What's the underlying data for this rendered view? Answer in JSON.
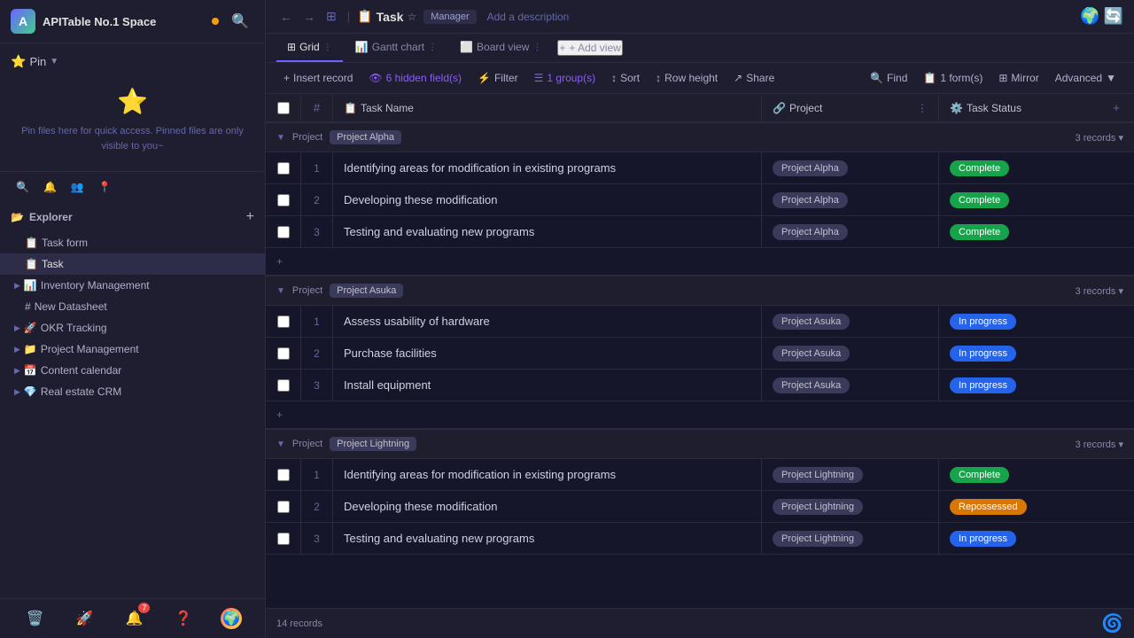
{
  "app": {
    "space_name": "APITable No.1 Space",
    "space_dot_color": "#f59e0b",
    "avatar_letter": "A"
  },
  "sidebar": {
    "pin_label": "Pin",
    "pin_empty_text": "Pin files here for quick access. Pinned files are only visible to you~",
    "explorer_label": "Explorer",
    "nav_items": [
      {
        "icon": "👤",
        "label": "",
        "type": "user"
      },
      {
        "icon": "🔍",
        "label": "",
        "type": "search"
      },
      {
        "icon": "🚀",
        "label": "",
        "type": "rocket"
      },
      {
        "icon": "📍",
        "label": "",
        "type": "pin"
      }
    ],
    "tree_items": [
      {
        "icon": "📋",
        "label": "Task form",
        "color": "#ef4444",
        "indent": 1,
        "active": false
      },
      {
        "icon": "📋",
        "label": "Task",
        "color": "#ef4444",
        "indent": 1,
        "active": true
      },
      {
        "icon": "📊",
        "label": "Inventory Management",
        "color": "#6c63ff",
        "indent": 0,
        "active": false,
        "has_children": true
      },
      {
        "icon": "#",
        "label": "New Datasheet",
        "color": "#8888aa",
        "indent": 1,
        "active": false
      },
      {
        "icon": "🚀",
        "label": "OKR Tracking",
        "color": "#f59e0b",
        "indent": 0,
        "active": false,
        "has_children": true
      },
      {
        "icon": "📁",
        "label": "Project Management",
        "color": "#f59e0b",
        "indent": 0,
        "active": false,
        "has_children": true
      },
      {
        "icon": "📅",
        "label": "Content calendar",
        "color": "#6c63ff",
        "indent": 0,
        "active": false,
        "has_children": true
      },
      {
        "icon": "💎",
        "label": "Real estate CRM",
        "color": "#f59e0b",
        "indent": 0,
        "active": false,
        "has_children": true
      }
    ],
    "bottom_icons": [
      "🗑️",
      "🚀",
      "👤"
    ],
    "notification_count": 7
  },
  "header": {
    "task_title": "Task",
    "manager_label": "Manager",
    "add_description": "Add a description"
  },
  "view_tabs": [
    {
      "label": "Grid",
      "icon": "⊞",
      "active": true,
      "dot": false
    },
    {
      "label": "Gantt chart",
      "icon": "📊",
      "active": false
    },
    {
      "label": "Board view",
      "icon": "⬜",
      "active": false
    }
  ],
  "add_view_label": "+ Add view",
  "action_bar": {
    "insert_record": "Insert record",
    "hidden_fields": "6 hidden field(s)",
    "filter": "Filter",
    "group": "1 group(s)",
    "sort": "Sort",
    "row_height": "Row height",
    "share": "Share",
    "find": "Find",
    "form": "1 form(s)",
    "mirror": "Mirror",
    "advanced": "Advanced"
  },
  "columns": [
    {
      "label": "Task Name",
      "icon": "📋"
    },
    {
      "label": "Project",
      "icon": "🔗"
    },
    {
      "label": "Task Status",
      "icon": "⚙️"
    }
  ],
  "groups": [
    {
      "id": "group_alpha",
      "project_label": "Project",
      "project_name": "Project Alpha",
      "records_count": "3 records",
      "rows": [
        {
          "num": 1,
          "name": "Identifying areas for modification in existing programs",
          "project": "Project Alpha",
          "status": "Complete",
          "status_class": "tag-green"
        },
        {
          "num": 2,
          "name": "Developing these modification",
          "project": "Project Alpha",
          "status": "Complete",
          "status_class": "tag-green"
        },
        {
          "num": 3,
          "name": "Testing and evaluating new programs",
          "project": "Project Alpha",
          "status": "Complete",
          "status_class": "tag-green"
        }
      ]
    },
    {
      "id": "group_asuka",
      "project_label": "Project",
      "project_name": "Project Asuka",
      "records_count": "3 records",
      "rows": [
        {
          "num": 1,
          "name": "Assess usability of hardware",
          "project": "Project Asuka",
          "status": "In progress",
          "status_class": "tag-blue"
        },
        {
          "num": 2,
          "name": "Purchase facilities",
          "project": "Project Asuka",
          "status": "In progress",
          "status_class": "tag-blue"
        },
        {
          "num": 3,
          "name": "Install equipment",
          "project": "Project Asuka",
          "status": "In progress",
          "status_class": "tag-blue"
        }
      ]
    },
    {
      "id": "group_lightning",
      "project_label": "Project",
      "project_name": "Project Lightning",
      "records_count": "3 records",
      "rows": [
        {
          "num": 1,
          "name": "Identifying areas for modification in existing programs",
          "project": "Project Lightning",
          "status": "Complete",
          "status_class": "tag-green"
        },
        {
          "num": 2,
          "name": "Developing these modification",
          "project": "Project Lightning",
          "status": "Repossessed",
          "status_class": "tag-yellow"
        },
        {
          "num": 3,
          "name": "Testing and evaluating new programs",
          "project": "Project Lightning",
          "status": "In progress",
          "status_class": "tag-blue"
        }
      ]
    }
  ],
  "total_records": "14 records",
  "colors": {
    "active_tab_border": "#6c63ff",
    "complete_green": "#16a34a",
    "in_progress_blue": "#2563eb",
    "repossessed_yellow": "#d97706"
  }
}
